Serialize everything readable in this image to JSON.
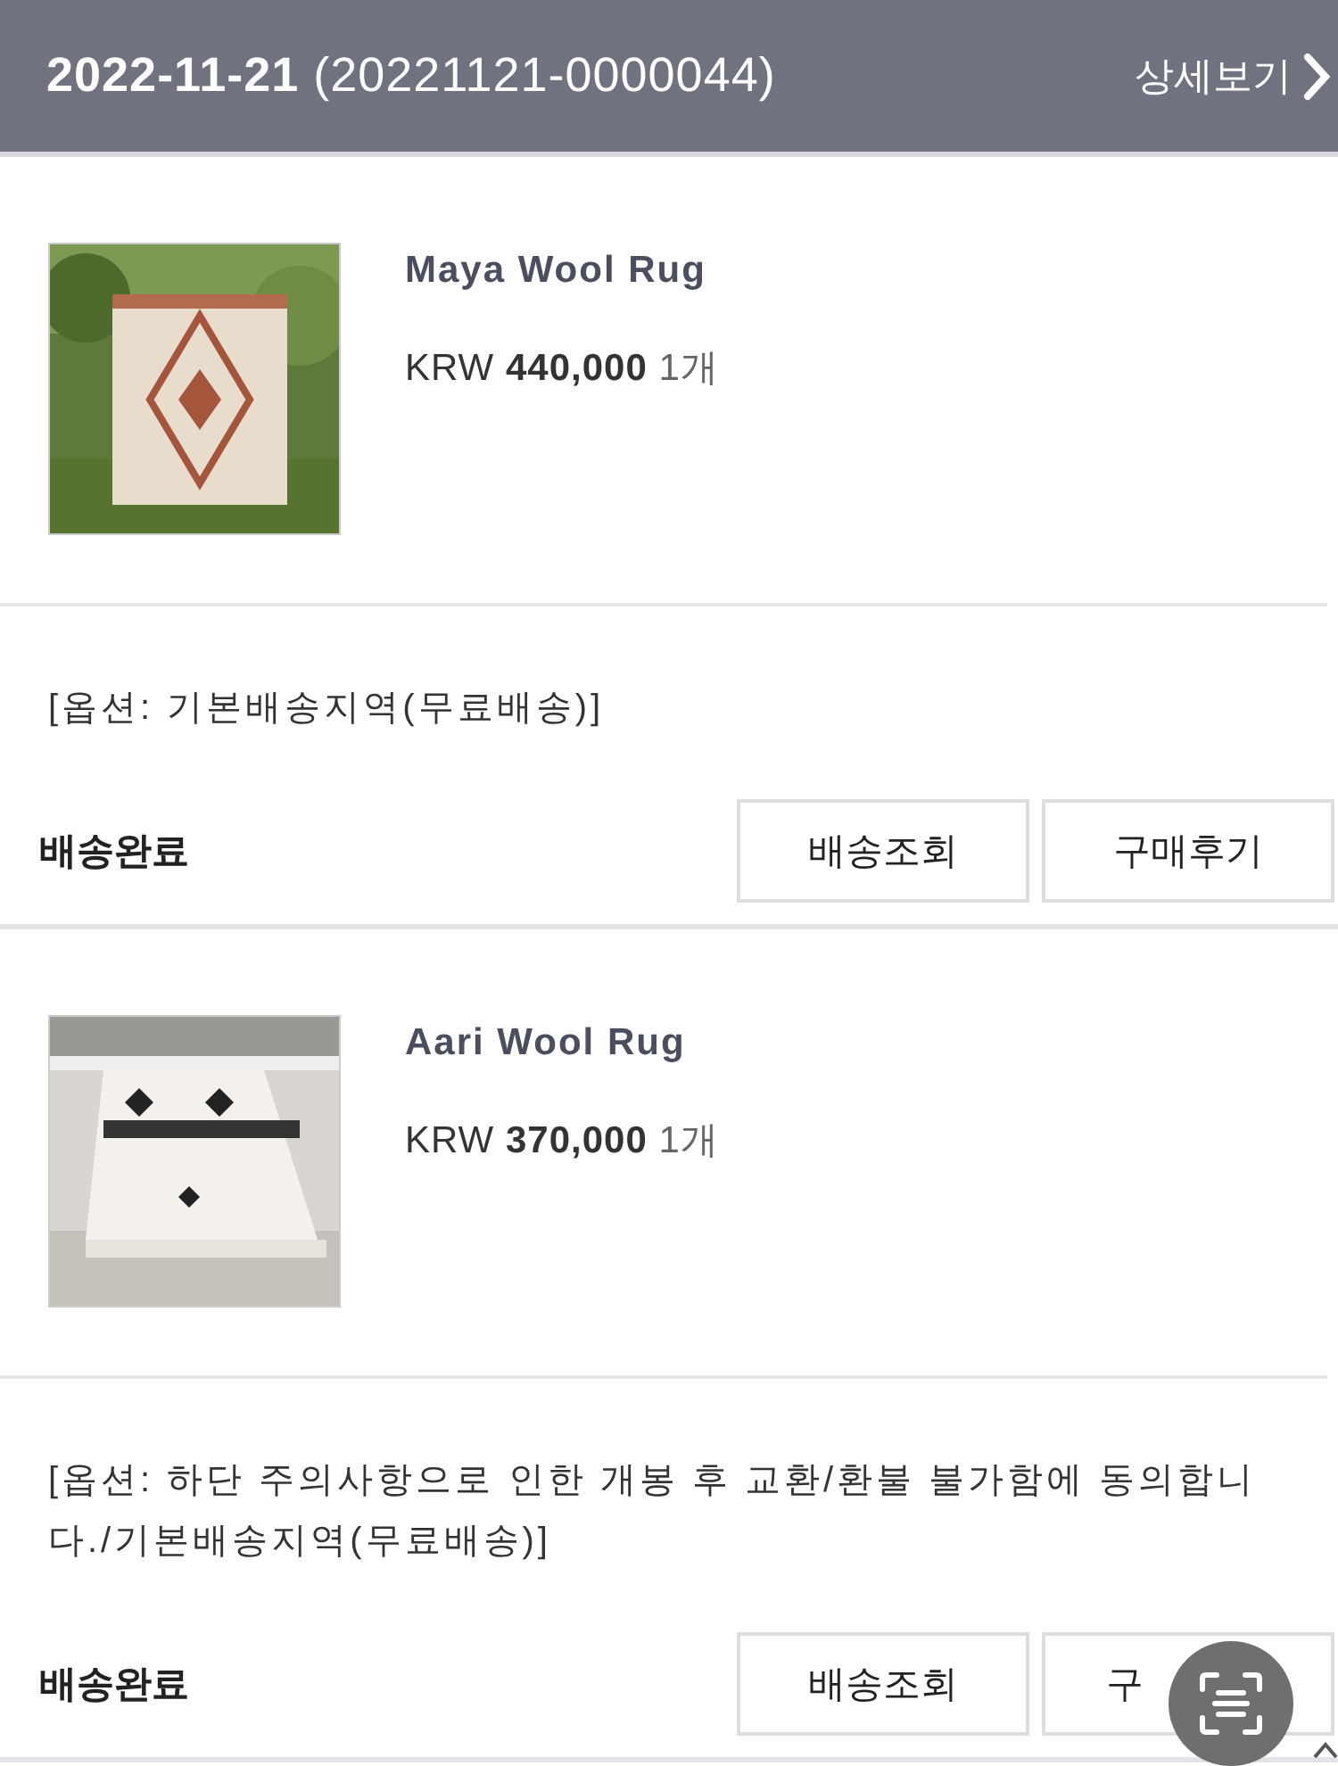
{
  "order_header": {
    "date": "2022-11-21",
    "order_number": "(20221121-0000044)",
    "details_link": "상세보기"
  },
  "items": [
    {
      "name": "Maya Wool Rug",
      "currency": "KRW",
      "price": "440,000",
      "quantity": "1개",
      "option": "[옵션: 기본배송지역(무료배송)]",
      "status": "배송완료",
      "buttons": [
        {
          "label": "배송조회",
          "covered": false
        },
        {
          "label": "구매후기",
          "covered": false
        }
      ]
    },
    {
      "name": "Aari Wool Rug",
      "currency": "KRW",
      "price": "370,000",
      "quantity": "1개",
      "option": "[옵션: 하단 주의사항으로 인한 개봉 후 교환/환불 불가함에 동의합니다./기본배송지역(무료배송)]",
      "status": "배송완료",
      "buttons": [
        {
          "label": "배송조회",
          "covered": false
        },
        {
          "label": "구",
          "covered": true
        }
      ]
    }
  ]
}
